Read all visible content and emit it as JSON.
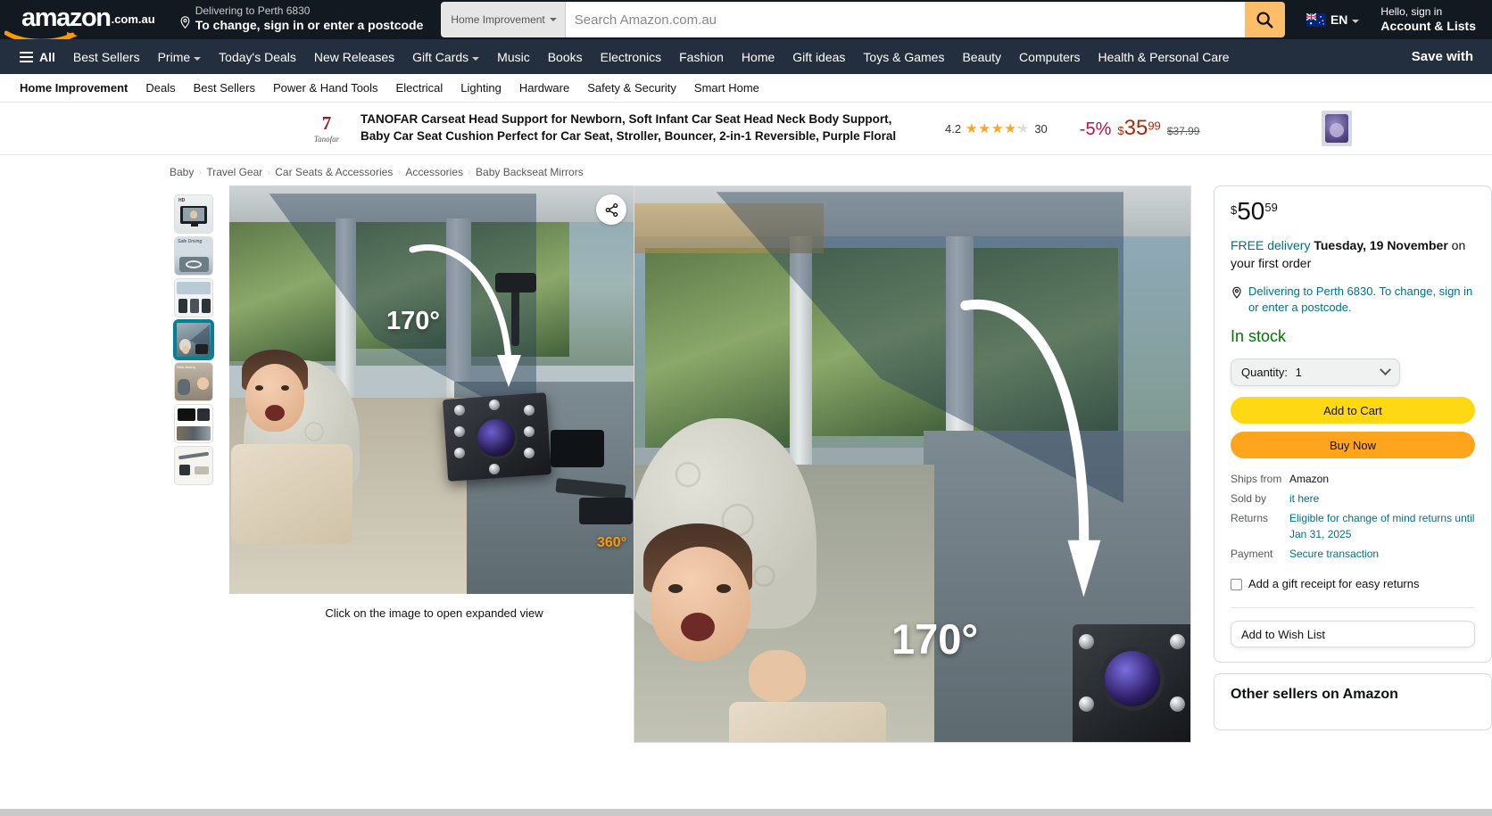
{
  "header": {
    "logo_word": "amazon",
    "logo_tld": ".com.au",
    "deliver_line1": "Delivering to Perth 6830",
    "deliver_line2": "To change, sign in or enter a postcode",
    "search_category": "Home Improvement",
    "search_placeholder": "Search Amazon.com.au",
    "search_value": "",
    "language_code": "EN",
    "account_line1": "Hello, sign in",
    "account_line2": "Account & Lists"
  },
  "nav": {
    "all_label": "All",
    "items": [
      {
        "label": "Best Sellers",
        "caret": false
      },
      {
        "label": "Prime",
        "caret": true
      },
      {
        "label": "Today's Deals",
        "caret": false
      },
      {
        "label": "New Releases",
        "caret": false
      },
      {
        "label": "Gift Cards",
        "caret": true
      },
      {
        "label": "Music",
        "caret": false
      },
      {
        "label": "Books",
        "caret": false
      },
      {
        "label": "Electronics",
        "caret": false
      },
      {
        "label": "Fashion",
        "caret": false
      },
      {
        "label": "Home",
        "caret": false
      },
      {
        "label": "Gift ideas",
        "caret": false
      },
      {
        "label": "Toys & Games",
        "caret": false
      },
      {
        "label": "Beauty",
        "caret": false
      },
      {
        "label": "Computers",
        "caret": false
      },
      {
        "label": "Health & Personal Care",
        "caret": false
      }
    ],
    "promo": "Save with"
  },
  "subnav": {
    "items": [
      "Home Improvement",
      "Deals",
      "Best Sellers",
      "Power & Hand Tools",
      "Electrical",
      "Lighting",
      "Hardware",
      "Safety & Security",
      "Smart Home"
    ]
  },
  "banner": {
    "brand_mark": "7",
    "brand_name": "Tanofar",
    "title": "TANOFAR Carseat Head Support for Newborn, Soft Infant Car Seat Head Neck Body Support, Baby Car Seat Cushion Perfect for Car Seat, Stroller, Bouncer, 2-in-1 Reversible, Purple Floral",
    "rating_value": "4.2",
    "rating_count": "30",
    "discount": "-5%",
    "price_currency": "$",
    "price_whole": "35",
    "price_frac": "99",
    "price_was": "$37.99"
  },
  "breadcrumbs": [
    "Baby",
    "Travel Gear",
    "Car Seats & Accessories",
    "Accessories",
    "Baby Backseat Mirrors"
  ],
  "gallery": {
    "thumbs": [
      {
        "name": "thumbnail-1-monitor"
      },
      {
        "name": "thumbnail-2-safe-driving"
      },
      {
        "name": "thumbnail-3-install-steps"
      },
      {
        "name": "thumbnail-4-170-degree-view"
      },
      {
        "name": "thumbnail-5-rear-seat"
      },
      {
        "name": "thumbnail-6-screen-set"
      },
      {
        "name": "thumbnail-7-accessories"
      }
    ],
    "selected_index": 3,
    "caption": "Click on the image to open expanded view",
    "overlay_angle": "170°",
    "overlay_badge": "360°"
  },
  "buybox": {
    "price_currency": "$",
    "price_whole": "50",
    "price_frac": "59",
    "delivery_free": "FREE delivery",
    "delivery_date": "Tuesday, 19 November",
    "delivery_tail": " on your first order",
    "location_text": "Delivering to Perth 6830. To change, sign in or enter a postcode.",
    "stock_status": "In stock",
    "quantity_label": "Quantity:",
    "quantity_value": "1",
    "add_to_cart": "Add to Cart",
    "buy_now": "Buy Now",
    "meta": [
      {
        "key": "Ships from",
        "value": "Amazon",
        "link": false
      },
      {
        "key": "Sold by",
        "value": "it here",
        "link": true
      },
      {
        "key": "Returns",
        "value": "Eligible for change of mind returns until Jan 31, 2025",
        "link": true
      },
      {
        "key": "Payment",
        "value": "Secure transaction",
        "link": true
      }
    ],
    "gift_receipt_label": "Add a gift receipt for easy returns",
    "wish_list": "Add to Wish List",
    "other_sellers_title": "Other sellers on Amazon"
  },
  "colors": {
    "header_bg": "#131921",
    "nav_bg": "#232f3e",
    "accent_orange": "#febd69",
    "cart_yellow": "#ffd814",
    "buy_orange": "#ffa41c",
    "link_teal": "#007185",
    "in_stock_green": "#007600",
    "price_red": "#b12704",
    "discount_red": "#cc0c39",
    "thumb_selected": "#008296"
  }
}
